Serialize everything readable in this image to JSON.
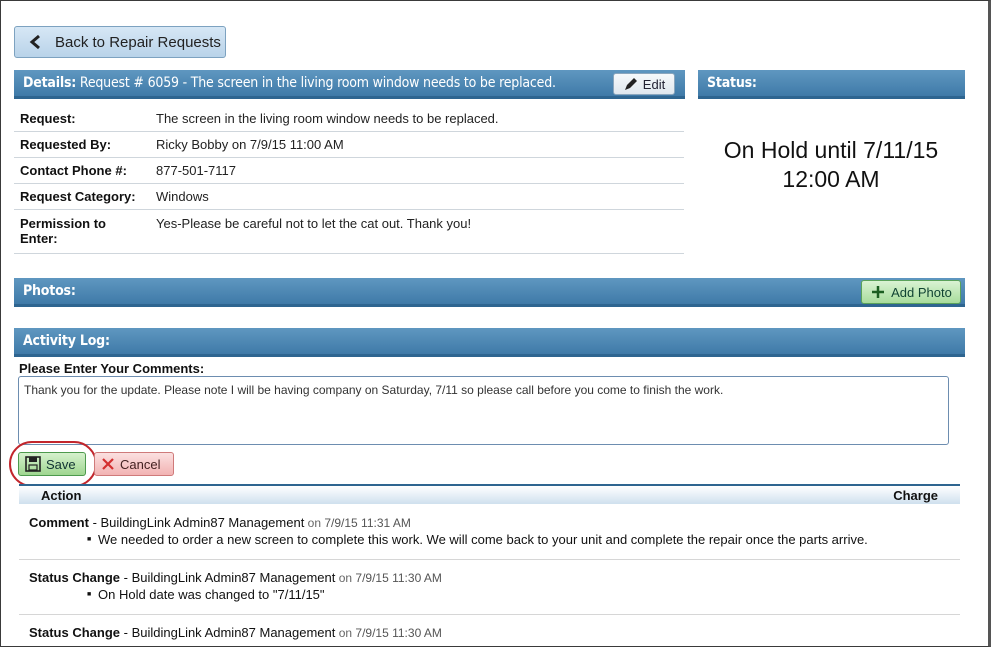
{
  "nav": {
    "back_label": "Back to Repair Requests"
  },
  "details": {
    "header_label": "Details:",
    "header_title": "Request # 6059 - The screen in the living room window needs to be replaced.",
    "edit_label": "Edit",
    "rows": [
      {
        "label": "Request:",
        "value": "The screen in the living room window needs to be replaced."
      },
      {
        "label": "Requested By:",
        "value": "Ricky Bobby on 7/9/15 11:00 AM"
      },
      {
        "label": "Contact Phone #:",
        "value": "877-501-7117"
      },
      {
        "label": "Request Category:",
        "value": "Windows"
      },
      {
        "label": "Permission to Enter:",
        "value": "Yes-Please be careful not to let the cat out. Thank you!"
      }
    ]
  },
  "status": {
    "header_label": "Status:",
    "line1": "On Hold until 7/11/15",
    "line2": "12:00 AM"
  },
  "photos": {
    "header_label": "Photos:",
    "add_label": "Add Photo"
  },
  "activity": {
    "header_label": "Activity Log:",
    "comments_label": "Please Enter Your Comments:",
    "comment_value": "Thank you for the update. Please note I will be having company on Saturday, 7/11 so please call before you come to finish the work.",
    "save_label": "Save",
    "cancel_label": "Cancel",
    "col_action": "Action",
    "col_charge": "Charge",
    "entries": [
      {
        "type": "Comment",
        "sep": " - ",
        "by": "BuildingLink Admin87 Management",
        "on": " on ",
        "when": "7/9/15 11:31 AM",
        "detail": "We needed to order a new screen to complete this work. We will come back to your unit and complete the repair once the parts arrive."
      },
      {
        "type": "Status Change",
        "sep": " - ",
        "by": "BuildingLink Admin87 Management",
        "on": " on ",
        "when": "7/9/15 11:30 AM",
        "detail": "On Hold date was changed to \"7/11/15\""
      },
      {
        "type": "Status Change",
        "sep": " - ",
        "by": "BuildingLink Admin87 Management",
        "on": " on ",
        "when": "7/9/15 11:30 AM"
      }
    ]
  },
  "colors": {
    "bar_blue": "#4a84b0",
    "save_green": "#9fd690",
    "cancel_red": "#f2b3b3",
    "highlight_ring": "#c2262c"
  }
}
